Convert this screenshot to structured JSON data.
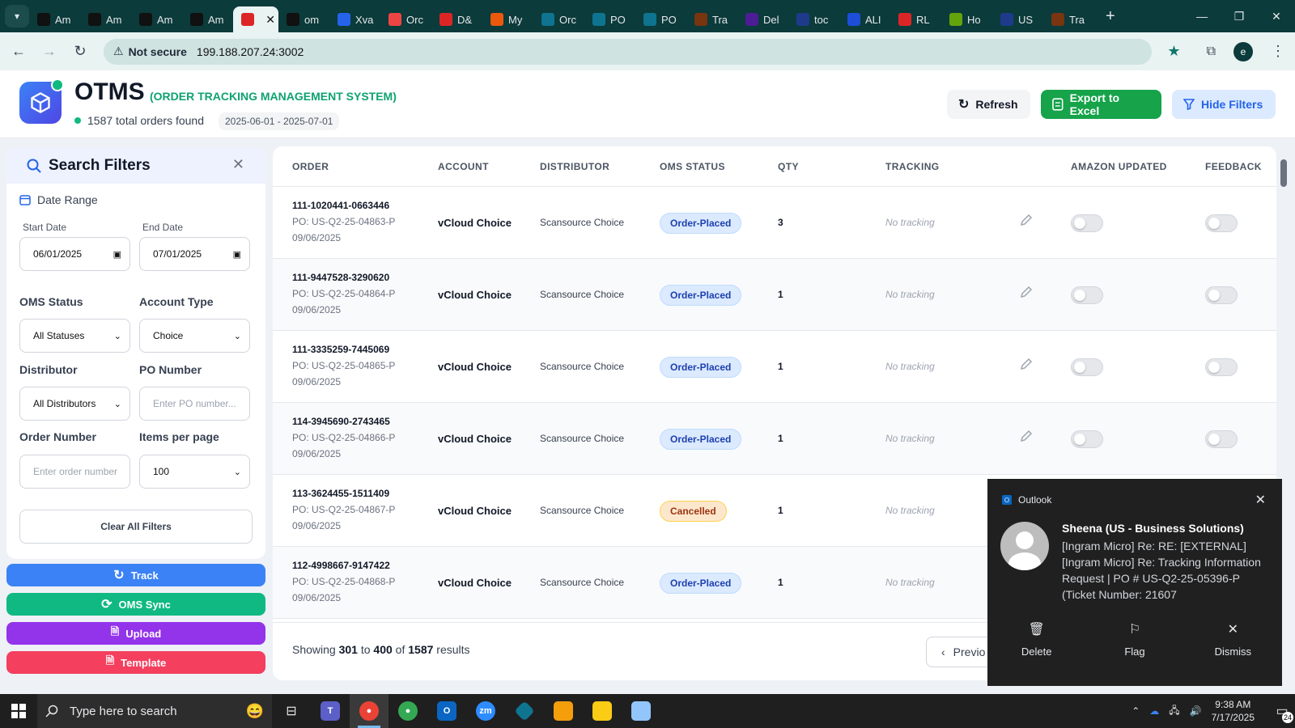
{
  "browser": {
    "tabs": [
      {
        "label": "Am",
        "icon": "amazon-icon",
        "color": "#111111"
      },
      {
        "label": "Am",
        "icon": "amazon-icon",
        "color": "#111111"
      },
      {
        "label": "Am",
        "icon": "amazon-icon",
        "color": "#111111"
      },
      {
        "label": "Am",
        "icon": "amazon-icon",
        "color": "#111111"
      },
      {
        "label": "",
        "icon": "otms-icon",
        "color": "#dc2626",
        "active": true
      },
      {
        "label": "om",
        "icon": "om-icon",
        "color": "#111111"
      },
      {
        "label": "Xva",
        "icon": "xva-icon",
        "color": "#2563eb"
      },
      {
        "label": "Orc",
        "icon": "orc-icon",
        "color": "#ef4444"
      },
      {
        "label": "D&",
        "icon": "dh-icon",
        "color": "#dc2626"
      },
      {
        "label": "My",
        "icon": "my-icon",
        "color": "#ea580c"
      },
      {
        "label": "Orc",
        "icon": "ec-icon",
        "color": "#0e7490"
      },
      {
        "label": "PO",
        "icon": "ec-icon",
        "color": "#0e7490"
      },
      {
        "label": "PO",
        "icon": "ec-icon",
        "color": "#0e7490"
      },
      {
        "label": "Tra",
        "icon": "ups-icon",
        "color": "#78350f"
      },
      {
        "label": "Del",
        "icon": "fedex-icon",
        "color": "#4c1d95"
      },
      {
        "label": "toc",
        "icon": "doc-icon",
        "color": "#1e3a8a"
      },
      {
        "label": "ALI",
        "icon": "ali-icon",
        "color": "#1d4ed8"
      },
      {
        "label": "RL",
        "icon": "rl-icon",
        "color": "#dc2626"
      },
      {
        "label": "Ho",
        "icon": "ho-icon",
        "color": "#65a30d"
      },
      {
        "label": "US",
        "icon": "us-icon",
        "color": "#1e3a8a"
      },
      {
        "label": "Tra",
        "icon": "ups-icon",
        "color": "#78350f"
      }
    ],
    "security_label": "Not secure",
    "url": "199.188.207.24:3002",
    "profile_initial": "e"
  },
  "header": {
    "title": "OTMS",
    "subtitle": "(ORDER TRACKING MANAGEMENT SYSTEM)",
    "total_text": "1587 total orders found",
    "date_range": "2025-06-01 - 2025-07-01",
    "refresh_label": "Refresh",
    "export_label": "Export to Excel",
    "hide_filters_label": "Hide Filters"
  },
  "filters": {
    "title": "Search Filters",
    "date_range_label": "Date Range",
    "start_date_label": "Start Date",
    "start_date_value": "06/01/2025",
    "end_date_label": "End Date",
    "end_date_value": "07/01/2025",
    "oms_status_label": "OMS Status",
    "oms_status_value": "All Statuses",
    "account_type_label": "Account Type",
    "account_type_value": "Choice",
    "distributor_label": "Distributor",
    "distributor_value": "All Distributors",
    "po_number_label": "PO Number",
    "po_number_placeholder": "Enter PO number...",
    "order_number_label": "Order Number",
    "order_number_placeholder": "Enter order number",
    "items_per_page_label": "Items per page",
    "items_per_page_value": "100",
    "clear_label": "Clear All Filters"
  },
  "actions": {
    "track": "Track",
    "oms_sync": "OMS Sync",
    "upload": "Upload",
    "template": "Template"
  },
  "table": {
    "columns": [
      "ORDER",
      "ACCOUNT",
      "DISTRIBUTOR",
      "OMS STATUS",
      "QTY",
      "TRACKING",
      "AMAZON UPDATED",
      "FEEDBACK"
    ],
    "rows": [
      {
        "order": "111-1020441-0663446",
        "po": "PO: US-Q2-25-04863-P",
        "date": "09/06/2025",
        "account": "vCloud Choice",
        "distributor": "Scansource Choice",
        "status": "Order-Placed",
        "qty": "3",
        "tracking": "No tracking"
      },
      {
        "order": "111-9447528-3290620",
        "po": "PO: US-Q2-25-04864-P",
        "date": "09/06/2025",
        "account": "vCloud Choice",
        "distributor": "Scansource Choice",
        "status": "Order-Placed",
        "qty": "1",
        "tracking": "No tracking"
      },
      {
        "order": "111-3335259-7445069",
        "po": "PO: US-Q2-25-04865-P",
        "date": "09/06/2025",
        "account": "vCloud Choice",
        "distributor": "Scansource Choice",
        "status": "Order-Placed",
        "qty": "1",
        "tracking": "No tracking"
      },
      {
        "order": "114-3945690-2743465",
        "po": "PO: US-Q2-25-04866-P",
        "date": "09/06/2025",
        "account": "vCloud Choice",
        "distributor": "Scansource Choice",
        "status": "Order-Placed",
        "qty": "1",
        "tracking": "No tracking"
      },
      {
        "order": "113-3624455-1511409",
        "po": "PO: US-Q2-25-04867-P",
        "date": "09/06/2025",
        "account": "vCloud Choice",
        "distributor": "Scansource Choice",
        "status": "Cancelled",
        "qty": "1",
        "tracking": "No tracking"
      },
      {
        "order": "112-4998667-9147422",
        "po": "PO: US-Q2-25-04868-P",
        "date": "09/06/2025",
        "account": "vCloud Choice",
        "distributor": "Scansource Choice",
        "status": "Order-Placed",
        "qty": "1",
        "tracking": "No tracking"
      }
    ]
  },
  "pagination": {
    "showing": "Showing",
    "from": "301",
    "to_word": "to",
    "to": "400",
    "of_word": "of",
    "total": "1587",
    "results": "results",
    "prev_label": "Previo"
  },
  "toast": {
    "app": "Outlook",
    "sender": "Sheena (US - Business Solutions)",
    "message": "[Ingram Micro] Re: RE: [EXTERNAL] [Ingram Micro] Re: Tracking Information Request | PO # US-Q2-25-05396-P (Ticket Number: 21607",
    "delete_label": "Delete",
    "flag_label": "Flag",
    "dismiss_label": "Dismiss"
  },
  "taskbar": {
    "search_placeholder": "Type here to search",
    "time": "9:38 AM",
    "date": "7/17/2025",
    "notifications": "24"
  },
  "colors": {
    "accent_blue": "#2563eb",
    "export_green": "#16a34a",
    "track": "#3b82f6",
    "oms_sync": "#10b981",
    "upload": "#9333ea",
    "template": "#f43f5e"
  }
}
